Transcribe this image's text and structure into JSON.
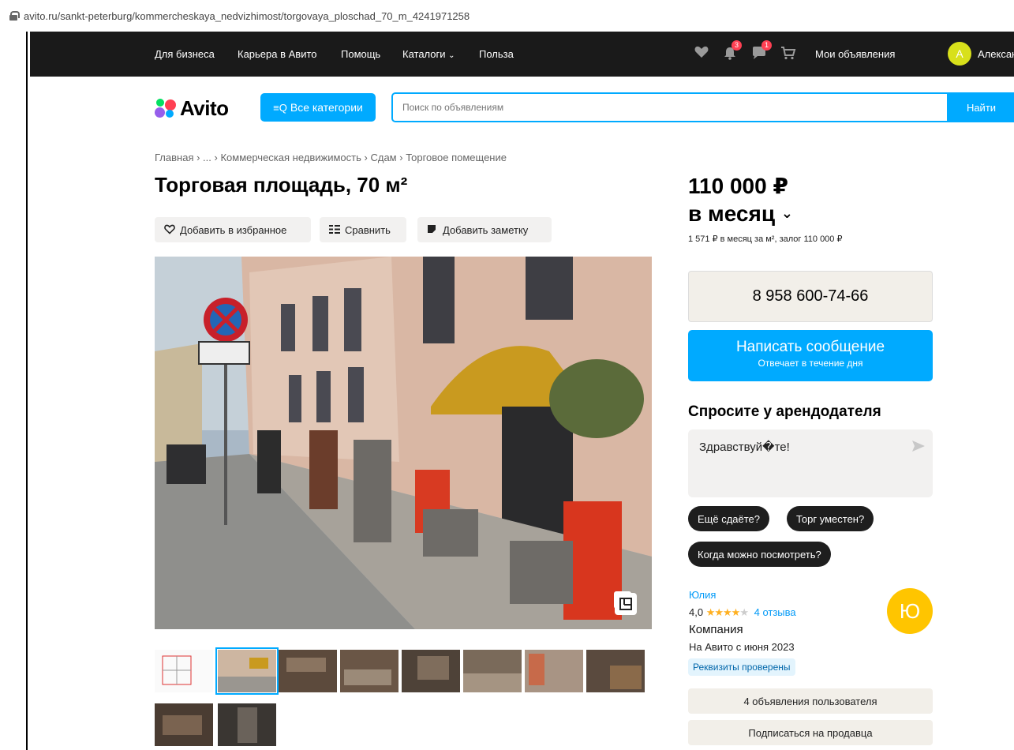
{
  "browser": {
    "url": "avito.ru/sankt-peterburg/kommercheskaya_nedvizhimost/torgovaya_ploschad_70_m_4241971258"
  },
  "topnav": {
    "links": [
      "Для бизнеса",
      "Карьера в Авито",
      "Помощь",
      "Каталоги",
      "Польза"
    ],
    "notifications_badge": "3",
    "messages_badge": "1",
    "my_ads": "Мои объявления",
    "user_initial": "А",
    "user_name": "Александра"
  },
  "header": {
    "logo": "Avito",
    "categories_button": "Все категории",
    "search_placeholder": "Поиск по объявлениям",
    "find_button": "Найти"
  },
  "breadcrumbs": [
    "Главная",
    "...",
    "Коммерческая недвижимость",
    "Сдам",
    "Торговое помещение"
  ],
  "listing": {
    "title": "Торговая площадь, 70 м²",
    "actions": {
      "favorite": "Добавить в избранное",
      "compare": "Сравнить",
      "note": "Добавить заметку"
    },
    "thumbnail_count": 10,
    "selected_thumbnail": 1
  },
  "pricing": {
    "price": "110 000 ₽",
    "period": "в месяц",
    "details": "1 571 ₽ в месяц за м², залог 110 000 ₽"
  },
  "contact": {
    "phone": "8 958 600-74-66",
    "message_button": "Написать сообщение",
    "message_sub": "Отвечает в течение дня",
    "ask_heading": "Спросите у арендодателя",
    "ask_text": "Здравствуй�те!",
    "quick_replies": [
      "Ещё сдаёте?",
      "Торг уместен?",
      "Когда можно посмотреть?"
    ]
  },
  "seller": {
    "name": "Юлия",
    "rating": "4,0",
    "rating_stars": 4,
    "reviews": "4 отзыва",
    "type": "Компания",
    "since": "На Авито с июня 2023",
    "verified": "Реквизиты проверены",
    "avatar_initial": "Ю",
    "ads_button": "4 объявления пользователя",
    "subscribe_button": "Подписаться на продавца"
  },
  "colors": {
    "accent": "#00aaff",
    "nav_bg": "#1a1a1a",
    "chip_bg": "#1e1e1e",
    "seller_avatar": "#ffc500"
  }
}
